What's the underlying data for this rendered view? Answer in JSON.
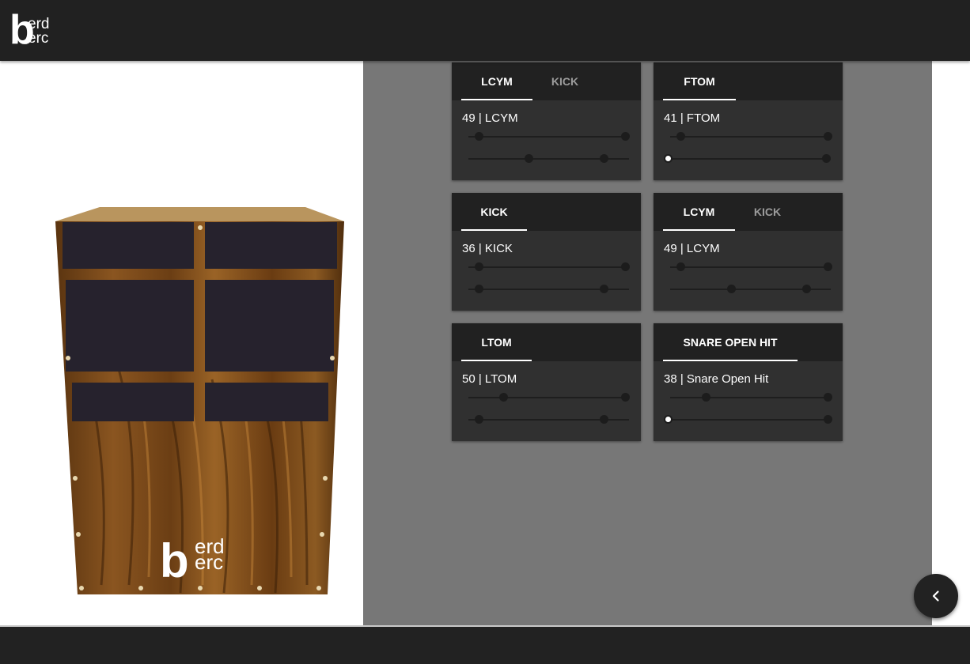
{
  "brand": {
    "letter": "b",
    "line1": "erd",
    "line2": "erc"
  },
  "cards": [
    {
      "tabs": [
        {
          "label": "LCYM",
          "active": true
        },
        {
          "label": "KICK",
          "active": false
        }
      ],
      "value": "49 | LCYM"
    },
    {
      "tabs": [
        {
          "label": "FTOM",
          "active": true
        }
      ],
      "value": "41 | FTOM"
    },
    {
      "tabs": [
        {
          "label": "KICK",
          "active": true
        }
      ],
      "value": "36 | KICK"
    },
    {
      "tabs": [
        {
          "label": "LCYM",
          "active": true
        },
        {
          "label": "KICK",
          "active": false
        }
      ],
      "value": "49 | LCYM"
    },
    {
      "tabs": [
        {
          "label": "LTOM",
          "active": true
        }
      ],
      "value": "50 | LTOM"
    },
    {
      "tabs": [
        {
          "label": "SNARE OPEN HIT",
          "active": true
        }
      ],
      "value": "38 | Snare Open Hit"
    }
  ],
  "colors": {
    "topbar": "#212121",
    "panel": "#777777",
    "card": "#303030",
    "card_header": "#212121",
    "wood": "#7a4a18",
    "pad": "#26222d"
  },
  "icons": {
    "fab": "chevron-left-icon"
  }
}
